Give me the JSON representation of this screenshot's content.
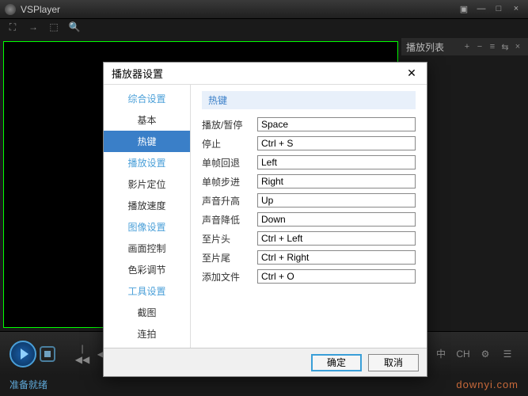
{
  "app": {
    "title": "VSPlayer"
  },
  "playlist": {
    "title": "播放列表"
  },
  "status": {
    "text": "准备就绪"
  },
  "watermark": "downyi.com",
  "langbtns": {
    "ch": "中",
    "en": "CH"
  },
  "dialog": {
    "title": "播放器设置",
    "sidebar": {
      "cat1": "综合设置",
      "items1": [
        "基本",
        "热键"
      ],
      "cat2": "播放设置",
      "items2": [
        "影片定位",
        "播放速度"
      ],
      "cat3": "图像设置",
      "items3": [
        "画面控制",
        "色彩调节"
      ],
      "cat4": "工具设置",
      "items4": [
        "截图",
        "连拍"
      ],
      "active": "热键"
    },
    "content": {
      "heading": "热键",
      "rows": [
        {
          "label": "播放/暂停",
          "value": "Space"
        },
        {
          "label": "停止",
          "value": "Ctrl + S"
        },
        {
          "label": "单帧回退",
          "value": "Left"
        },
        {
          "label": "单帧步进",
          "value": "Right"
        },
        {
          "label": "声音升高",
          "value": "Up"
        },
        {
          "label": "声音降低",
          "value": "Down"
        },
        {
          "label": "至片头",
          "value": "Ctrl + Left"
        },
        {
          "label": "至片尾",
          "value": "Ctrl + Right"
        },
        {
          "label": "添加文件",
          "value": "Ctrl + O"
        }
      ]
    },
    "buttons": {
      "ok": "确定",
      "cancel": "取消"
    }
  }
}
